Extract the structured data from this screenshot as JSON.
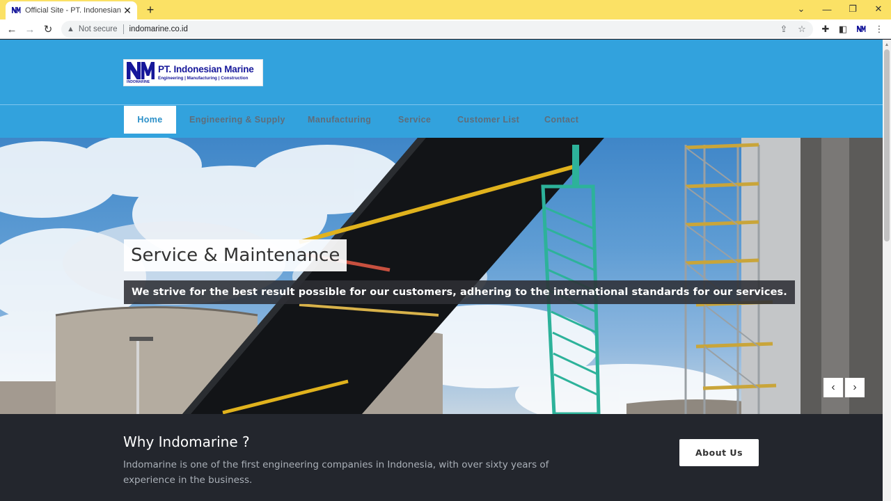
{
  "browser": {
    "tab_title": "Official Site - PT. Indonesian Mar",
    "security_label": "Not secure",
    "url": "indomarine.co.id",
    "favicon_text": "NM"
  },
  "site": {
    "logo": {
      "mark": "NM",
      "name": "PT. Indonesian Marine",
      "tagline": "Engineering | Manufacturing | Construction",
      "small_text": "INDOMARINE"
    },
    "nav": [
      {
        "label": "Home",
        "active": true
      },
      {
        "label": "Engineering & Supply",
        "active": false
      },
      {
        "label": "Manufacturing",
        "active": false
      },
      {
        "label": "Service",
        "active": false
      },
      {
        "label": "Customer List",
        "active": false
      },
      {
        "label": "Contact",
        "active": false
      }
    ],
    "hero": {
      "title": "Service & Maintenance",
      "text": "We strive for the best result possible for our customers, adhering to the international standards for our services.",
      "prev_glyph": "‹",
      "next_glyph": "›"
    },
    "why": {
      "title": "Why Indomarine ?",
      "text": "Indomarine is one of the first engineering companies in Indonesia, with over sixty years of experience in the business.",
      "button_label": "About Us"
    }
  },
  "colors": {
    "header_blue": "#32a2dd",
    "tab_bar_yellow": "#fbe165",
    "logo_navy": "#16179a",
    "footer_dark": "#23262d"
  }
}
